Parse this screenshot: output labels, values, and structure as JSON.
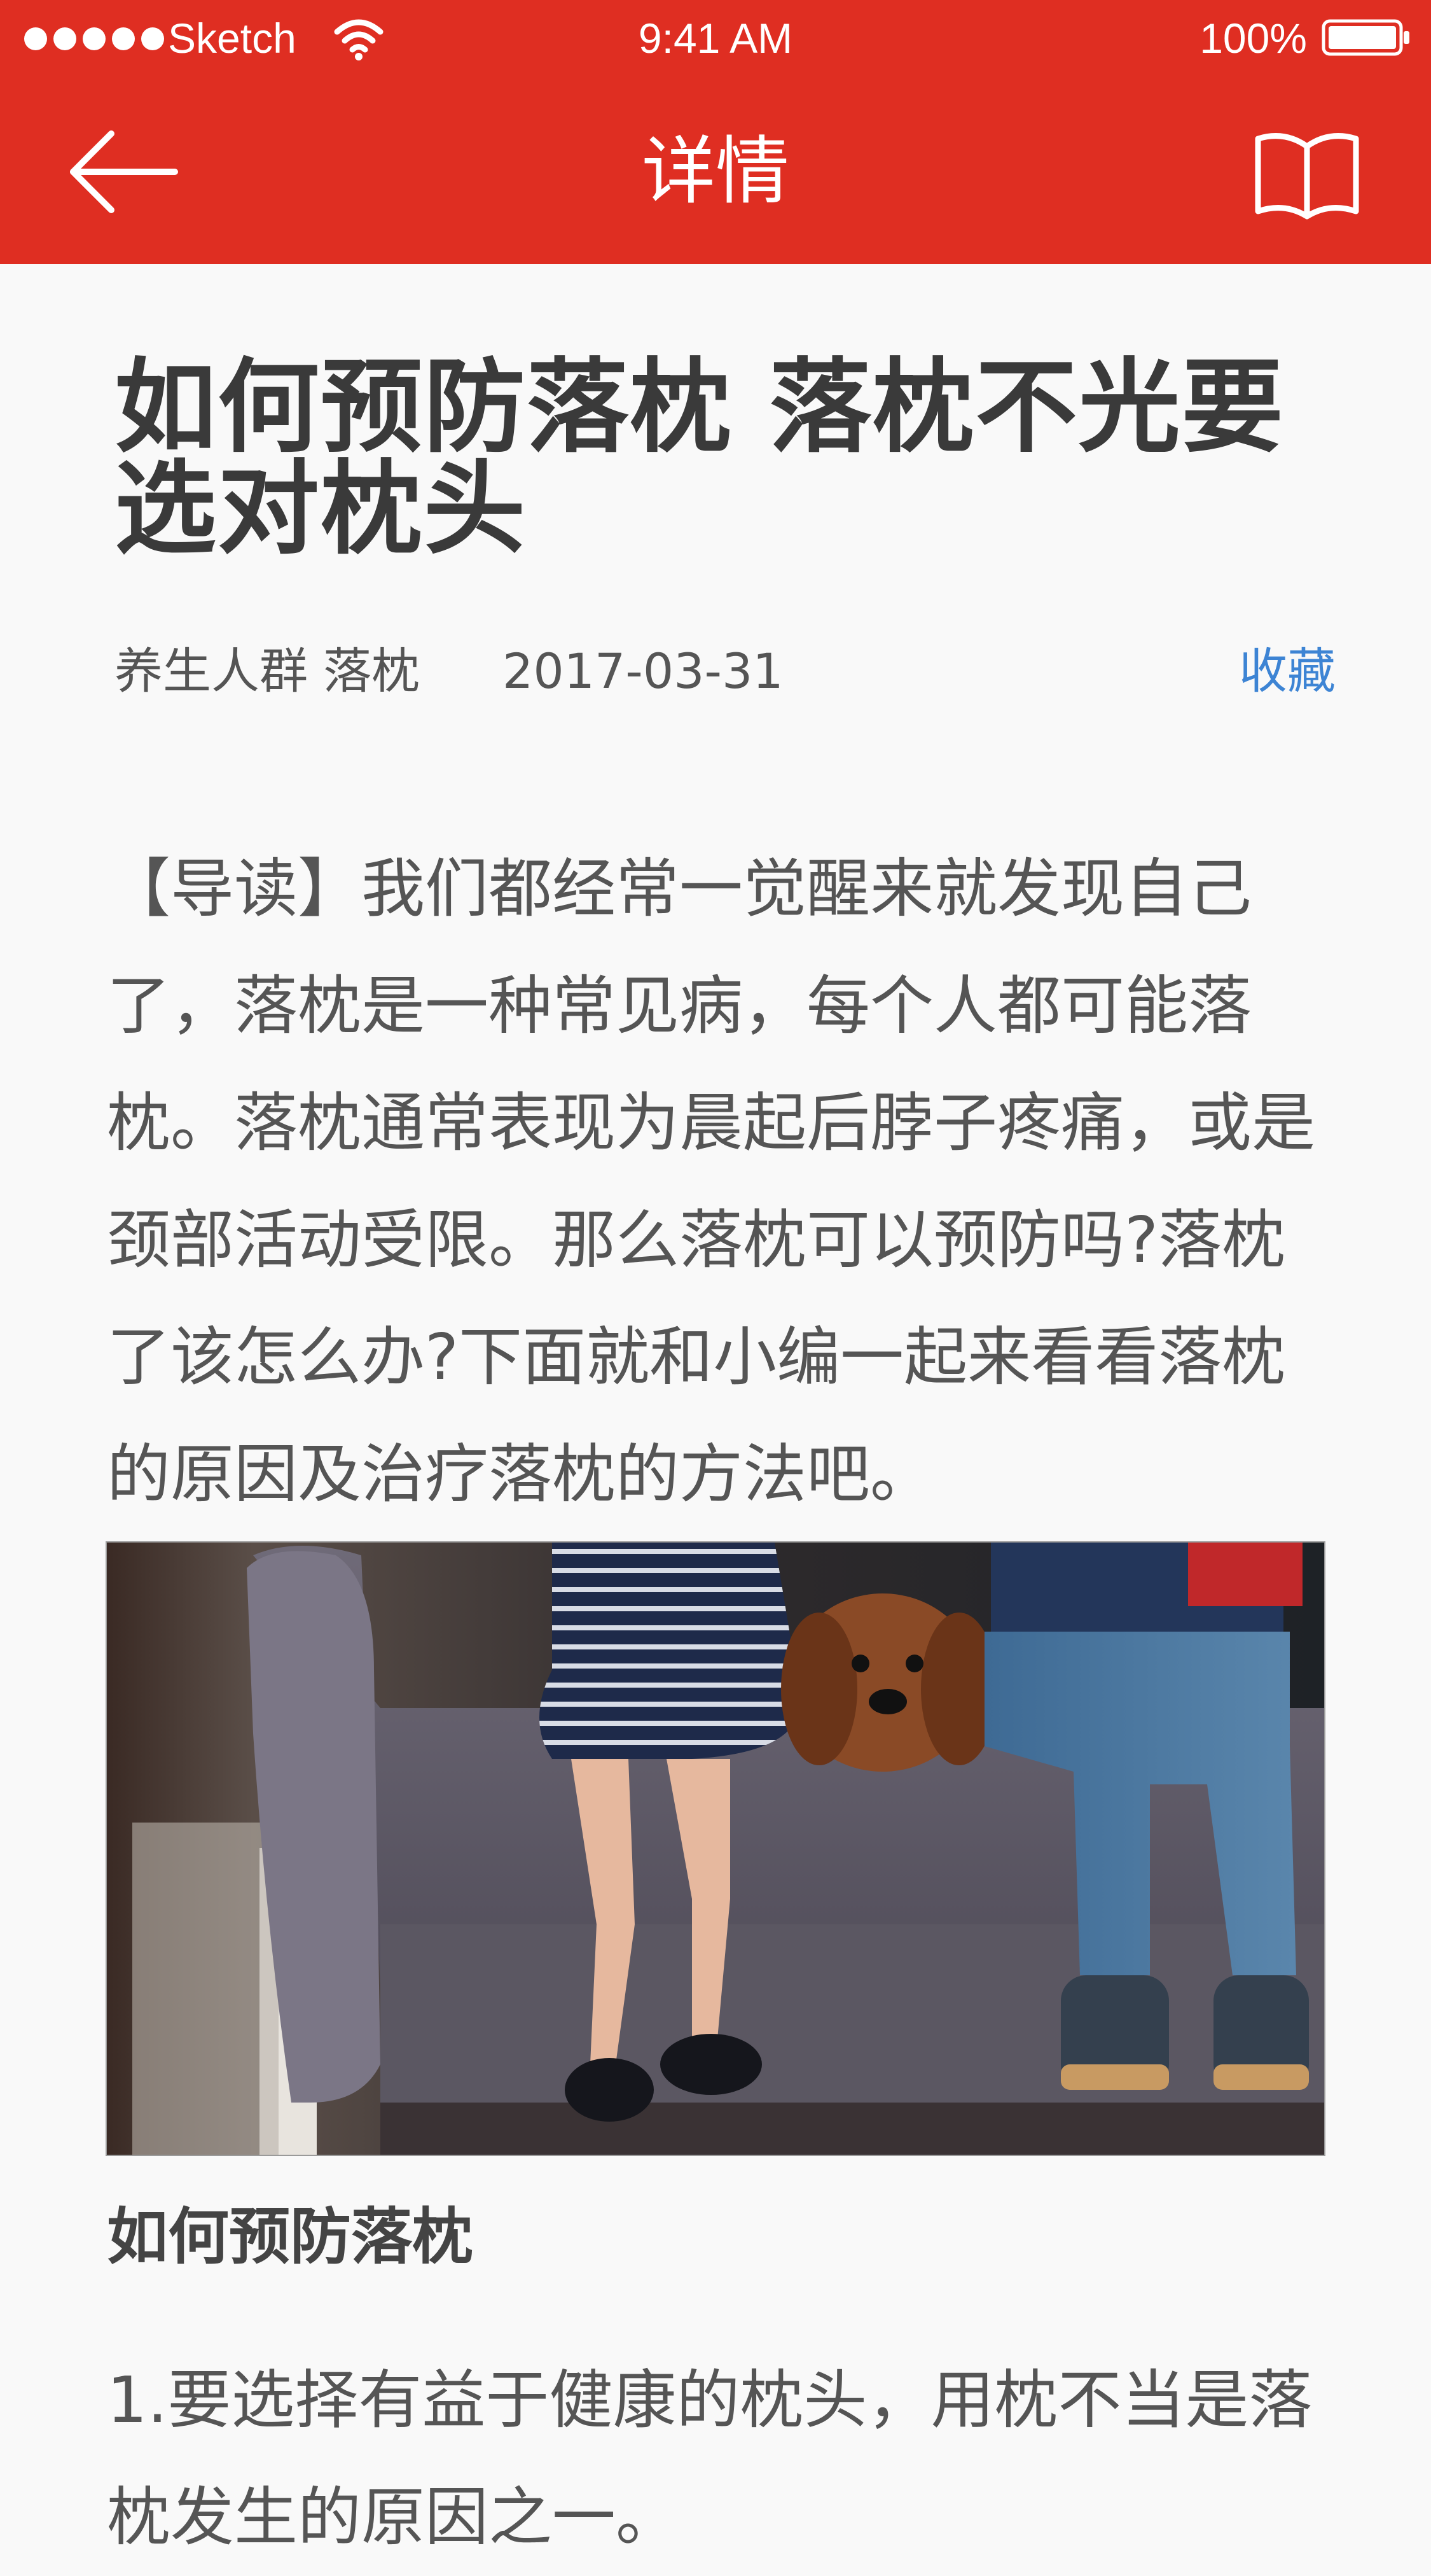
{
  "status_bar": {
    "carrier": "Sketch",
    "time": "9:41 AM",
    "battery": "100%"
  },
  "nav": {
    "title": "详情",
    "back_icon": "arrow-left-icon",
    "right_icon": "book-icon"
  },
  "article": {
    "title": "如何预防落枕 落枕不光要选对枕头",
    "tags": "养生人群 落枕",
    "date": "2017-03-31",
    "favorite_label": "收藏",
    "intro": "【导读】我们都经常一觉醒来就发现自己了，落枕是一种常见病，每个人都可能落枕。落枕通常表现为晨起后脖子疼痛，或是颈部活动受限。那么落枕可以预防吗?落枕了该怎么办?下面就和小编一起来看看落枕的原因及治疗落枕的方法吧。",
    "section_heading": "如何预防落枕",
    "point_1": "1.要选择有益于健康的枕头，用枕不当是落枕发生的原因之一。"
  },
  "colors": {
    "brand_red": "#df2e22",
    "link_blue": "#3d84d4"
  }
}
